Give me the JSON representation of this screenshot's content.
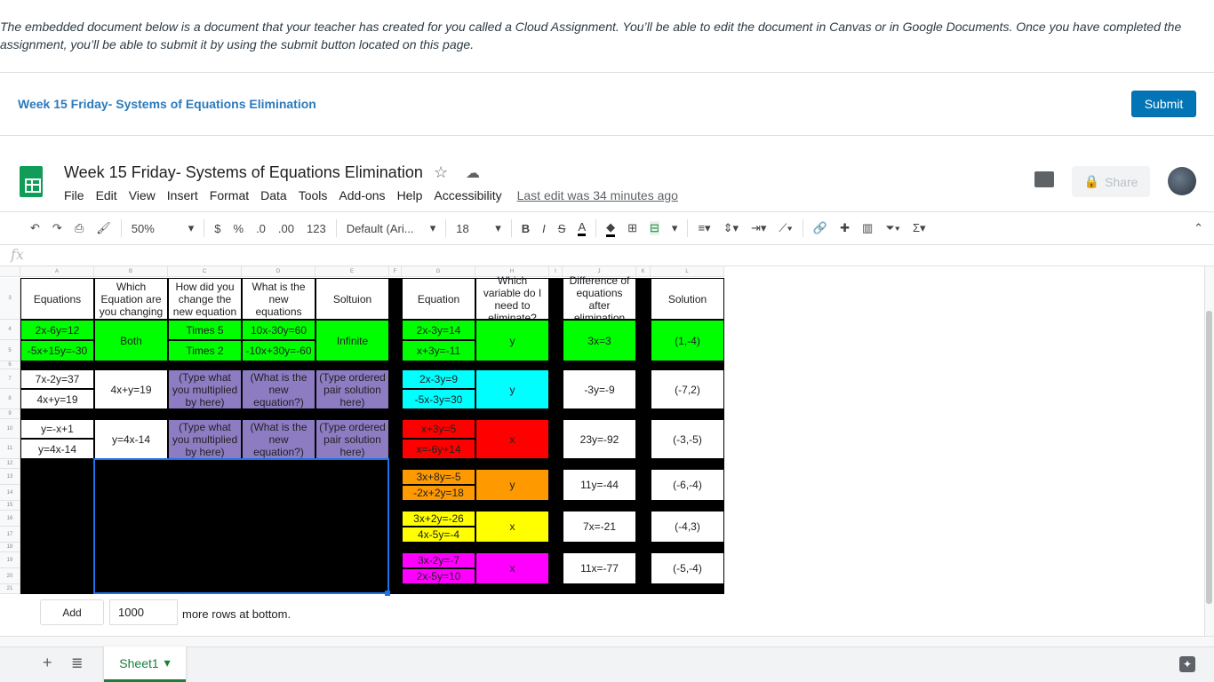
{
  "intro": "The embedded document below is a document that your teacher has created for you called a Cloud Assignment. You’ll be able to edit the document in Canvas or in Google Documents. Once you have completed the assignment, you’ll be able to submit it by using the submit button located on this page.",
  "doc_link": "Week 15 Friday- Systems of Equations Elimination",
  "submit": "Submit",
  "sheet": {
    "title": "Week 15 Friday- Systems of Equations Elimination",
    "menu": [
      "File",
      "Edit",
      "View",
      "Insert",
      "Format",
      "Data",
      "Tools",
      "Add-ons",
      "Help",
      "Accessibility"
    ],
    "last_edit": "Last edit was 34 minutes ago",
    "share": "Share",
    "toolbar": {
      "zoom": "50%",
      "currency": "$",
      "percent": "%",
      "dec_less": ".0",
      "dec_more": ".00",
      "format": "123",
      "font": "Default (Ari...",
      "size": "18"
    },
    "fx": "fx",
    "columns": [
      "A",
      "B",
      "C",
      "D",
      "E",
      "F",
      "G",
      "H",
      "I",
      "J",
      "K",
      "L"
    ],
    "rows": [
      "3",
      "4",
      "5",
      "6",
      "7",
      "8",
      "9",
      "10",
      "11",
      "12",
      "13",
      "14",
      "15",
      "16",
      "17",
      "18",
      "19",
      "20",
      "21"
    ],
    "cells": [
      {
        "c": 0,
        "r": 0,
        "t": "Equations",
        "bg": "#ffffff"
      },
      {
        "c": 1,
        "r": 0,
        "t": "Which Equation are you changing",
        "bg": "#ffffff"
      },
      {
        "c": 2,
        "r": 0,
        "t": "How did you change the new equation",
        "bg": "#ffffff"
      },
      {
        "c": 3,
        "r": 0,
        "t": "What is the new equations",
        "bg": "#ffffff"
      },
      {
        "c": 4,
        "r": 0,
        "t": "Soltuion",
        "bg": "#ffffff"
      },
      {
        "c": 0,
        "r": 1,
        "t": "2x-6y=12",
        "bg": "#00ff00"
      },
      {
        "c": 0,
        "r": 2,
        "t": "-5x+15y=-30",
        "bg": "#00ff00"
      },
      {
        "c": 1,
        "r": 1,
        "rs": 2,
        "t": "Both",
        "bg": "#00ff00"
      },
      {
        "c": 2,
        "r": 1,
        "t": "Times 5",
        "bg": "#00ff00"
      },
      {
        "c": 2,
        "r": 2,
        "t": "Times 2",
        "bg": "#00ff00"
      },
      {
        "c": 3,
        "r": 1,
        "t": "10x-30y=60",
        "bg": "#00ff00"
      },
      {
        "c": 3,
        "r": 2,
        "t": "-10x+30y=-60",
        "bg": "#00ff00"
      },
      {
        "c": 4,
        "r": 1,
        "rs": 2,
        "t": "Infinite",
        "bg": "#00ff00"
      },
      {
        "c": 0,
        "r": 4,
        "t": "7x-2y=37",
        "bg": "#ffffff"
      },
      {
        "c": 0,
        "r": 5,
        "t": "4x+y=19",
        "bg": "#ffffff"
      },
      {
        "c": 1,
        "r": 4,
        "rs": 2,
        "t": "4x+y=19",
        "bg": "#ffffff"
      },
      {
        "c": 2,
        "r": 4,
        "rs": 2,
        "t": "(Type what you multiplied by here)",
        "bg": "#8e7cc3"
      },
      {
        "c": 3,
        "r": 4,
        "rs": 2,
        "t": "(What is the new equation?)",
        "bg": "#8e7cc3"
      },
      {
        "c": 4,
        "r": 4,
        "rs": 2,
        "t": "(Type ordered pair solution here)",
        "bg": "#8e7cc3"
      },
      {
        "c": 0,
        "r": 7,
        "t": "y=-x+1",
        "bg": "#ffffff"
      },
      {
        "c": 0,
        "r": 8,
        "t": "y=4x-14",
        "bg": "#ffffff"
      },
      {
        "c": 1,
        "r": 7,
        "rs": 2,
        "t": "y=4x-14",
        "bg": "#ffffff"
      },
      {
        "c": 2,
        "r": 7,
        "rs": 2,
        "t": "(Type what you multiplied by here)",
        "bg": "#8e7cc3"
      },
      {
        "c": 3,
        "r": 7,
        "rs": 2,
        "t": "(What is the new equation?)",
        "bg": "#8e7cc3"
      },
      {
        "c": 4,
        "r": 7,
        "rs": 2,
        "t": "(Type ordered pair solution here)",
        "bg": "#8e7cc3"
      },
      {
        "c": 6,
        "r": 0,
        "t": "Equation",
        "bg": "#ffffff"
      },
      {
        "c": 7,
        "r": 0,
        "t": "Which variable do I need to eliminate?",
        "bg": "#ffffff"
      },
      {
        "c": 9,
        "r": 0,
        "t": "Difference of equations after elimination",
        "bg": "#ffffff"
      },
      {
        "c": 11,
        "r": 0,
        "t": "Solution",
        "bg": "#ffffff"
      },
      {
        "c": 6,
        "r": 1,
        "t": "2x-3y=14",
        "bg": "#00ff00"
      },
      {
        "c": 6,
        "r": 2,
        "t": "x+3y=-11",
        "bg": "#00ff00"
      },
      {
        "c": 7,
        "r": 1,
        "rs": 2,
        "t": "y",
        "bg": "#00ff00"
      },
      {
        "c": 9,
        "r": 1,
        "rs": 2,
        "t": "3x=3",
        "bg": "#00ff00"
      },
      {
        "c": 11,
        "r": 1,
        "rs": 2,
        "t": "(1,-4)",
        "bg": "#00ff00"
      },
      {
        "c": 6,
        "r": 4,
        "t": "2x-3y=9",
        "bg": "#00ffff"
      },
      {
        "c": 6,
        "r": 5,
        "t": "-5x-3y=30",
        "bg": "#00ffff"
      },
      {
        "c": 7,
        "r": 4,
        "rs": 2,
        "t": "y",
        "bg": "#00ffff"
      },
      {
        "c": 9,
        "r": 4,
        "rs": 2,
        "t": "-3y=-9",
        "bg": "#ffffff"
      },
      {
        "c": 11,
        "r": 4,
        "rs": 2,
        "t": "(-7,2)",
        "bg": "#ffffff"
      },
      {
        "c": 6,
        "r": 7,
        "t": "x+3y=5",
        "bg": "#ff0000"
      },
      {
        "c": 6,
        "r": 8,
        "t": "x=-6y+14",
        "bg": "#ff0000"
      },
      {
        "c": 7,
        "r": 7,
        "rs": 2,
        "t": "x",
        "bg": "#ff0000"
      },
      {
        "c": 9,
        "r": 7,
        "rs": 2,
        "t": "23y=-92",
        "bg": "#ffffff"
      },
      {
        "c": 11,
        "r": 7,
        "rs": 2,
        "t": "(-3,-5)",
        "bg": "#ffffff"
      },
      {
        "c": 6,
        "r": 10,
        "t": "3x+8y=-5",
        "bg": "#ff9900"
      },
      {
        "c": 6,
        "r": 11,
        "t": "-2x+2y=18",
        "bg": "#ff9900"
      },
      {
        "c": 7,
        "r": 10,
        "rs": 2,
        "t": "y",
        "bg": "#ff9900"
      },
      {
        "c": 9,
        "r": 10,
        "rs": 2,
        "t": "11y=-44",
        "bg": "#ffffff"
      },
      {
        "c": 11,
        "r": 10,
        "rs": 2,
        "t": "(-6,-4)",
        "bg": "#ffffff"
      },
      {
        "c": 6,
        "r": 13,
        "t": "3x+2y=-26",
        "bg": "#ffff00"
      },
      {
        "c": 6,
        "r": 14,
        "t": "4x-5y=-4",
        "bg": "#ffff00"
      },
      {
        "c": 7,
        "r": 13,
        "rs": 2,
        "t": "x",
        "bg": "#ffff00"
      },
      {
        "c": 9,
        "r": 13,
        "rs": 2,
        "t": "7x=-21",
        "bg": "#ffffff"
      },
      {
        "c": 11,
        "r": 13,
        "rs": 2,
        "t": "(-4,3)",
        "bg": "#ffffff"
      },
      {
        "c": 6,
        "r": 16,
        "t": "3x-2y=-7",
        "bg": "#ff00ff"
      },
      {
        "c": 6,
        "r": 17,
        "t": "2x-5y=10",
        "bg": "#ff00ff"
      },
      {
        "c": 7,
        "r": 16,
        "rs": 2,
        "t": "x",
        "bg": "#ff00ff"
      },
      {
        "c": 9,
        "r": 16,
        "rs": 2,
        "t": "11x=-77",
        "bg": "#ffffff"
      },
      {
        "c": 11,
        "r": 16,
        "rs": 2,
        "t": "(-5,-4)",
        "bg": "#ffffff"
      }
    ],
    "add_label": "Add",
    "add_rows": "1000",
    "add_text": "more rows at bottom.",
    "tab": "Sheet1"
  }
}
